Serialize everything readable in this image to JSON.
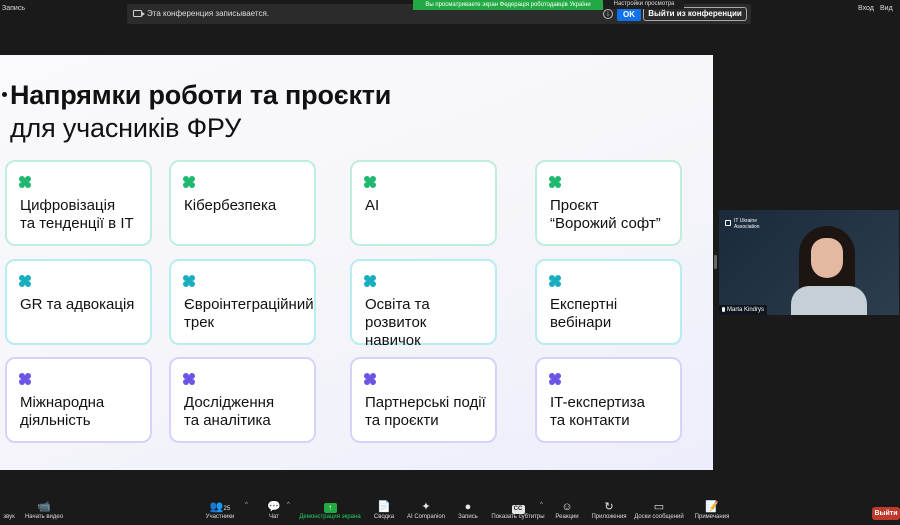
{
  "top": {
    "left_label": "Запись",
    "recording_text": "Эта конференция записывается.",
    "share_banner": "Вы просматриваете экран Федерація роботодавців України",
    "view_settings": "Настройки просмотра",
    "ok_label": "OK",
    "leave_label": "Выйти из конференции",
    "right_1": "Вход",
    "right_2": "Вид"
  },
  "slide": {
    "title_line1": "Напрямки роботи та проєкти",
    "title_line2": "для учасників ФРУ",
    "cards": [
      {
        "label": "Цифровізація\nта тенденції в IT",
        "tone": "green"
      },
      {
        "label": "Кібербезпека",
        "tone": "green"
      },
      {
        "label": "AI",
        "tone": "green"
      },
      {
        "label": "Проєкт\n“Ворожий софт”",
        "tone": "green"
      },
      {
        "label": "GR та адвокація",
        "tone": "cyan"
      },
      {
        "label": "Євроінтеграційний\nтрек",
        "tone": "cyan"
      },
      {
        "label": "Освіта та розвиток\nнавичок",
        "tone": "cyan"
      },
      {
        "label": "Експертні\nвебінари",
        "tone": "cyan"
      },
      {
        "label": "Міжнародна\nдіяльність",
        "tone": "purple"
      },
      {
        "label": "Дослідження\nта аналітика",
        "tone": "purple"
      },
      {
        "label": "Партнерські події\nта проєкти",
        "tone": "purple"
      },
      {
        "label": "IT-експертиза\nта контакти",
        "tone": "purple"
      }
    ],
    "icon_colors": {
      "green": "#1fb870",
      "cyan": "#19aebf",
      "purple": "#6a55e6"
    }
  },
  "video": {
    "logo_text": "IT Ukraine\nAssociation",
    "participant_name": "Marta Kindrys"
  },
  "toolbar": {
    "sound": "звук",
    "start_video": "Начать видео",
    "participants": "Участники",
    "participants_count": "25",
    "chat": "Чат",
    "share_screen": "Демонстрация экрана",
    "summary": "Сводка",
    "ai_companion": "AI Companion",
    "record": "Запись",
    "captions": "Показать субтитры",
    "reactions": "Реакции",
    "apps": "Приложения",
    "whiteboards": "Доски сообщений",
    "notes": "Примечания",
    "exit": "Выйти"
  }
}
